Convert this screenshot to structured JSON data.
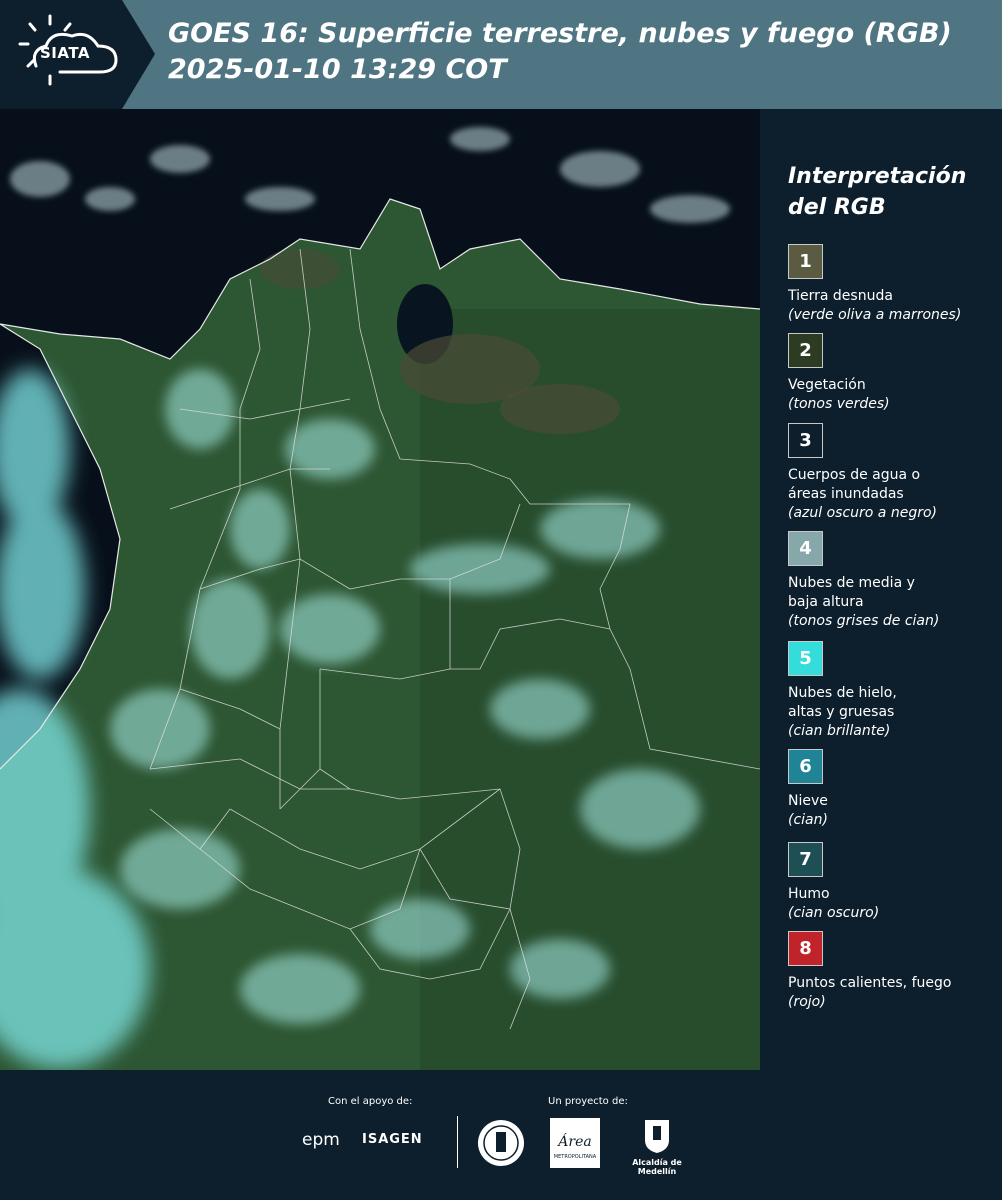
{
  "header": {
    "logo_text": "SIATA",
    "title_line1": "GOES 16: Superficie terrestre, nubes y fuego (RGB)",
    "title_line2": " 2025-01-10 13:29 COT"
  },
  "legend": {
    "title_line1": "Interpretación",
    "title_line2": "del RGB",
    "items": [
      {
        "num": "1",
        "color": "#5b5b42",
        "label": "Tierra desnuda",
        "label2": "",
        "sub": "(verde oliva a marrones)"
      },
      {
        "num": "2",
        "color": "#2c3c22",
        "label": "Vegetación",
        "label2": "",
        "sub": "(tonos verdes)"
      },
      {
        "num": "3",
        "color": "#0d1f2c",
        "label": "Cuerpos de agua o",
        "label2": "áreas inundadas",
        "sub": "(azul oscuro a negro)"
      },
      {
        "num": "4",
        "color": "#86a8aa",
        "label": "Nubes de media y",
        "label2": "baja altura",
        "sub": "(tonos grises de cian)"
      },
      {
        "num": "5",
        "color": "#35dcdc",
        "label": "Nubes de hielo,",
        "label2": "altas y gruesas",
        "sub": "(cian brillante)"
      },
      {
        "num": "6",
        "color": "#1f8496",
        "label": "Nieve",
        "label2": "",
        "sub": "(cian)"
      },
      {
        "num": "7",
        "color": "#1d4f54",
        "label": "Humo",
        "label2": "",
        "sub": "(cian oscuro)"
      },
      {
        "num": "8",
        "color": "#c0232a",
        "label": "Puntos calientes, fuego",
        "label2": "",
        "sub": "(rojo)"
      }
    ]
  },
  "footer": {
    "support_label": "Con el apoyo de:",
    "project_label": "Un proyecto de:",
    "epm": "epm",
    "isagen": "ISAGEN",
    "area_text": "Área",
    "area_sub": "METROPOLITANA",
    "medellin": "Alcaldía de Medellín"
  },
  "colors": {
    "header_bg": "#4f7482",
    "page_bg": "#0d1f2c",
    "vegetation": "#2f5a34",
    "cloud_cyan": "#7fe6e6",
    "ocean": "#0a1018"
  }
}
